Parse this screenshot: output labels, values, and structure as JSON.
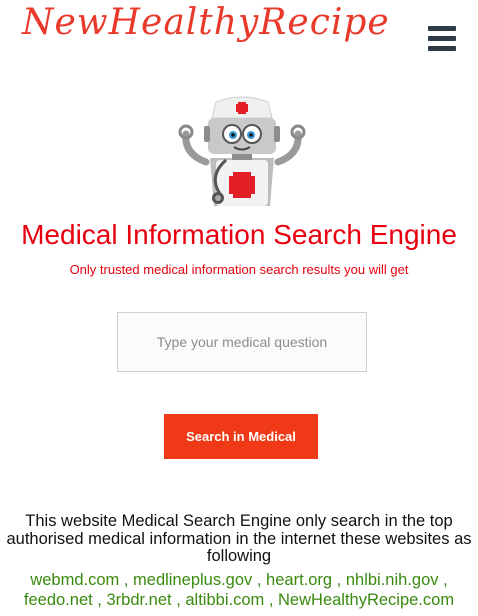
{
  "header": {
    "logo_text": "NewHealthyRecipe",
    "menu_icon": "hamburger-menu-icon"
  },
  "hero": {
    "illustration": "doctor-robot-icon",
    "title": "Medical Information Search Engine",
    "subtitle": "Only trusted medical information search results you will get"
  },
  "search": {
    "placeholder": "Type your medical question",
    "value": "",
    "button_label": "Search in Medical"
  },
  "info": {
    "description": "This website Medical Search Engine only search in the top authorised medical information in the internet these websites as following",
    "sites": [
      "webmd.com",
      "medlineplus.gov",
      "heart.org",
      "nhlbi.nih.gov",
      "feedo.net",
      "3rbdr.net",
      "altibbi.com",
      "NewHealthyRecipe.com"
    ]
  },
  "colors": {
    "brand_red": "#e8392b",
    "title_red": "#e8000f",
    "button": "#f03a17",
    "link_green": "#3a8a10"
  }
}
